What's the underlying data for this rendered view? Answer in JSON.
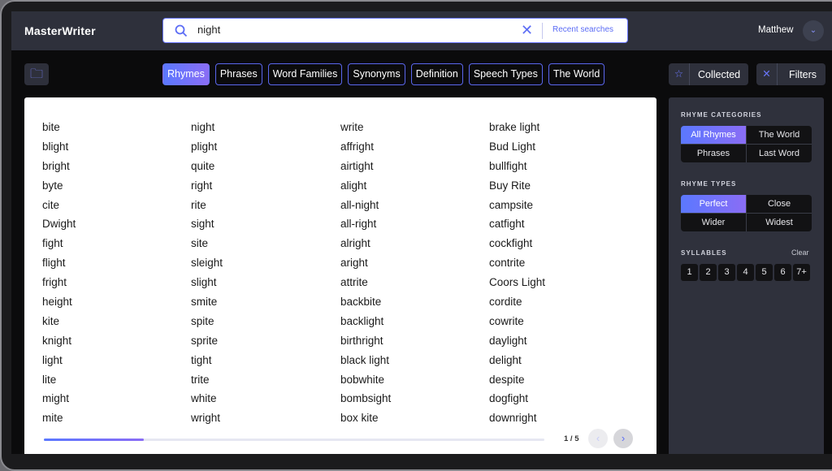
{
  "header": {
    "logo": "MasterWriter",
    "search_value": "night",
    "recent_label": "Recent searches",
    "user": "Matthew"
  },
  "tabs": [
    {
      "label": "Rhymes",
      "active": true
    },
    {
      "label": "Phrases"
    },
    {
      "label": "Word Families"
    },
    {
      "label": "Synonyms"
    },
    {
      "label": "Definition"
    },
    {
      "label": "Speech Types"
    },
    {
      "label": "The World"
    }
  ],
  "actions": {
    "collected": "Collected",
    "filters": "Filters"
  },
  "columns": [
    [
      "bite",
      "blight",
      "bright",
      "byte",
      "cite",
      "Dwight",
      "fight",
      "flight",
      "fright",
      "height",
      "kite",
      "knight",
      "light",
      "lite",
      "might",
      "mite"
    ],
    [
      "night",
      "plight",
      "quite",
      "right",
      "rite",
      "sight",
      "site",
      "sleight",
      "slight",
      "smite",
      "spite",
      "sprite",
      "tight",
      "trite",
      "white",
      "wright"
    ],
    [
      "write",
      "affright",
      "airtight",
      "alight",
      "all-night",
      "all-right",
      "alright",
      "aright",
      "attrite",
      "backbite",
      "backlight",
      "birthright",
      "black light",
      "bobwhite",
      "bombsight",
      "box kite"
    ],
    [
      "brake light",
      "Bud Light",
      "bullfight",
      "Buy Rite",
      "campsite",
      "catfight",
      "cockfight",
      "contrite",
      "Coors Light",
      "cordite",
      "cowrite",
      "daylight",
      "delight",
      "despite",
      "dogfight",
      "downright"
    ]
  ],
  "pagination": {
    "label": "1 / 5",
    "current": 1,
    "total": 5,
    "progress": 0.2
  },
  "sidebar": {
    "categories_title": "RHYME CATEGORIES",
    "categories": [
      "All Rhymes",
      "The World",
      "Phrases",
      "Last Word"
    ],
    "categories_selected": "All Rhymes",
    "types_title": "RHYME TYPES",
    "types": [
      "Perfect",
      "Close",
      "Wider",
      "Widest"
    ],
    "types_selected": "Perfect",
    "syllables_title": "SYLLABLES",
    "syllables_clear": "Clear",
    "syllables": [
      "1",
      "2",
      "3",
      "4",
      "5",
      "6",
      "7+"
    ]
  },
  "colors": {
    "accent": "#5b78ff",
    "accent2": "#8a6df5",
    "header": "#2e303b"
  }
}
